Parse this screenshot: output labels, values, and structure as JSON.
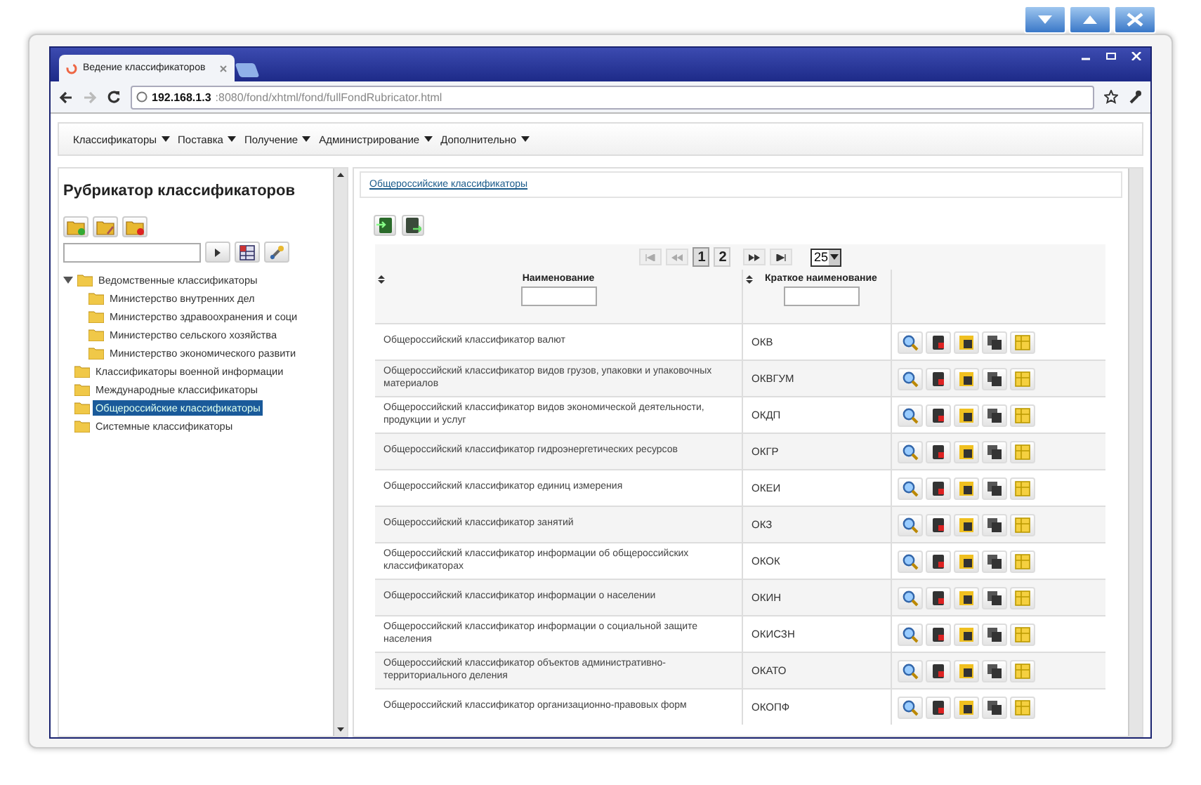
{
  "browser": {
    "tab_title": "Ведение классификаторов",
    "url_host": "192.168.1.3",
    "url_path": ":8080/fond/xhtml/fond/fullFondRubricator.html"
  },
  "menu": [
    {
      "label": "Классификаторы"
    },
    {
      "label": "Поставка"
    },
    {
      "label": "Получение"
    },
    {
      "label": "Администрирование"
    },
    {
      "label": "Дополнительно"
    }
  ],
  "sidebar": {
    "title": "Рубрикатор классификаторов",
    "tree": [
      {
        "label": "Ведомственные классификаторы",
        "expanded": true,
        "selected": false,
        "children": [
          {
            "label": "Министерство внутренних дел",
            "selected": false
          },
          {
            "label": "Министерство здравоохранения и соци",
            "selected": false
          },
          {
            "label": "Министерство сельского хозяйства",
            "selected": false
          },
          {
            "label": "Министерство экономического развити",
            "selected": false
          }
        ]
      },
      {
        "label": "Классификаторы военной информации",
        "selected": false
      },
      {
        "label": "Международные классификаторы",
        "selected": false
      },
      {
        "label": "Общероссийские классификаторы",
        "selected": true
      },
      {
        "label": "Системные классификаторы",
        "selected": false
      }
    ]
  },
  "breadcrumb": "Общероссийские классификаторы",
  "pager": {
    "pages": [
      {
        "label": "1",
        "selected": true
      },
      {
        "label": "2",
        "selected": false
      }
    ],
    "page_size": "25"
  },
  "table": {
    "columns": [
      "Наименование",
      "Краткое наименование"
    ],
    "rows": [
      {
        "name": "Общероссийский классификатор валют",
        "code": "ОКВ"
      },
      {
        "name": "Общероссийский классификатор видов грузов, упаковки и упаковочных материалов",
        "code": "ОКВГУМ"
      },
      {
        "name": "Общероссийский классификатор видов экономической деятельности, продукции и услуг",
        "code": "ОКДП"
      },
      {
        "name": "Общероссийский классификатор гидроэнергетических ресурсов",
        "code": "ОКГР"
      },
      {
        "name": "Общероссийский классификатор единиц измерения",
        "code": "ОКЕИ"
      },
      {
        "name": "Общероссийский классификатор занятий",
        "code": "ОКЗ"
      },
      {
        "name": "Общероссийский классификатор информации об общероссийских классификаторах",
        "code": "ОКОК"
      },
      {
        "name": "Общероссийский классификатор информации о населении",
        "code": "ОКИН"
      },
      {
        "name": "Общероссийский классификатор информации о социальной защите населения",
        "code": "ОКИСЗН"
      },
      {
        "name": "Общероссийский классификатор объектов административно-территориального деления",
        "code": "ОКАТО"
      },
      {
        "name": "Общероссийский классификатор организационно-правовых форм",
        "code": "ОКОПФ"
      }
    ]
  }
}
